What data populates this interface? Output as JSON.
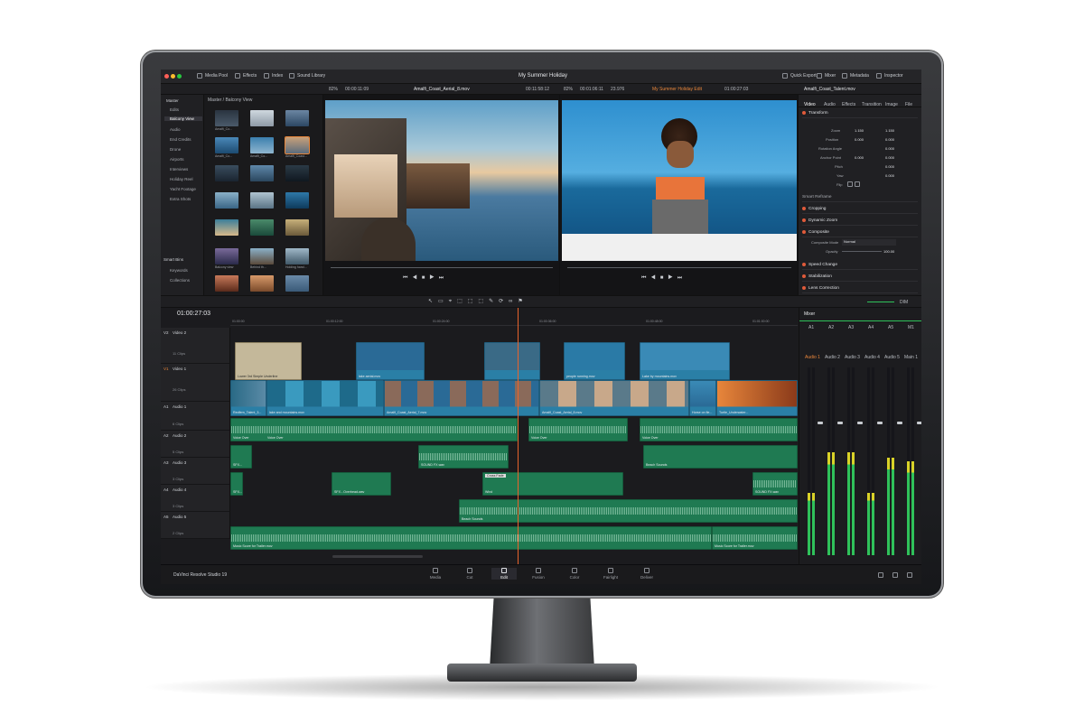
{
  "window": {
    "project_title": "My Summer Holiday",
    "tabs": [
      "Media Pool",
      "Effects",
      "Index",
      "Sound Library"
    ],
    "right_tabs": [
      "Quick Export",
      "Mixer",
      "Metadata",
      "Inspector"
    ]
  },
  "viewer_bar": {
    "zoom_left": "82%",
    "tc_left": "00:00:11:09",
    "clip_left": "Amalfi_Coast_Aerial_8.mov",
    "tc_left2": "00:11:58:12",
    "zoom_right": "82%",
    "tc_right": "00:01:06:11",
    "fps": "23.976",
    "timeline_name": "My Summer Holiday Edit",
    "tc_right2": "01:00:27:03",
    "inspector_clip": "Amalfi_Coast_Talent.mov"
  },
  "bins": {
    "master": "Master",
    "items": [
      "Edits",
      "Balcony View",
      "Audio",
      "End Credits",
      "Drone",
      "Airports",
      "Interviews",
      "Holiday Reel",
      "Yacht Footage",
      "Extra Shots"
    ],
    "smart_bins": "Smart Bins",
    "smart_items": [
      "Keywords",
      "Collections"
    ]
  },
  "pool": {
    "path": "Master / Balcony View",
    "labels": [
      "Amalfi_Co...",
      "Amalfi_Co...",
      "Amalfi_Co...",
      "Amalfi_Co...",
      "Amalfi_Co...",
      "Amalfi_Coast...",
      "Balcony view",
      "Behind th...",
      "Holding hand..."
    ]
  },
  "inspector": {
    "tabs": [
      "Video",
      "Audio",
      "Effects",
      "Transition",
      "Image",
      "File"
    ],
    "transform": "Transform",
    "fields": [
      {
        "label": "Zoom",
        "x": "1.150",
        "y": "1.150"
      },
      {
        "label": "Position",
        "x": "0.000",
        "y": "0.000"
      },
      {
        "label": "Rotation Angle",
        "x": "",
        "y": "0.000"
      },
      {
        "label": "Anchor Point",
        "x": "0.000",
        "y": "0.000"
      },
      {
        "label": "Pitch",
        "x": "",
        "y": "0.000"
      },
      {
        "label": "Yaw",
        "x": "",
        "y": "0.000"
      },
      {
        "label": "Flip",
        "x": "",
        "y": ""
      }
    ],
    "smart_reframe": "Smart Reframe",
    "cropping": "Cropping",
    "dynamic_zoom": "Dynamic Zoom",
    "composite": "Composite",
    "composite_mode_label": "Composite Mode",
    "composite_mode": "Normal",
    "opacity_label": "Opacity",
    "opacity": "100.00",
    "speed_change": "Speed Change",
    "stabilization": "Stabilization",
    "lens_correction": "Lens Correction"
  },
  "timeline": {
    "timecode": "01:00:27:03",
    "ruler": [
      "01:00:00",
      "01:00:12:00",
      "01:00:24:00",
      "01:00:36:00",
      "01:00:48:00",
      "01:01:00:00"
    ],
    "tracks": [
      {
        "id": "V2",
        "name": "Video 2",
        "clips": "11 Clips"
      },
      {
        "id": "V1",
        "name": "Video 1",
        "clips": "26 Clips"
      },
      {
        "id": "A1",
        "name": "Audio 1",
        "clips": "6 Clips"
      },
      {
        "id": "A2",
        "name": "Audio 2",
        "clips": "5 Clips"
      },
      {
        "id": "A3",
        "name": "Audio 3",
        "clips": "3 Clips"
      },
      {
        "id": "A4",
        "name": "Audio 4",
        "clips": "3 Clips"
      },
      {
        "id": "A5",
        "name": "Audio 5",
        "clips": "2 Clips"
      }
    ],
    "v2_clips": [
      "Lower 3rd Simple Underline",
      "lake aerial.mov",
      "people running.mov",
      "Lake by mountains.mov"
    ],
    "v1_clips": [
      "Redfern_Talent_3...",
      "lake and mountains.mov",
      "Amalfi_Coast_Aerial_7.mov",
      "Amalfi_Coast_Aerial_8.mov",
      "Horse on fie...",
      "Turtle_Underwater..."
    ],
    "a1_clips": [
      "Voice Over",
      "Voice Over",
      "Voice Over",
      "Voice Over"
    ],
    "a2_clips": [
      "SFX...",
      "SOUND FX.wav",
      "Beach Sounds"
    ],
    "a3_clips": [
      "SFX...",
      "SFX - Overhead.wav",
      "Cross Fade",
      "Wind",
      "SOUND FX.wav"
    ],
    "a4_clips": [
      "Beach Sounds"
    ],
    "a5_clips": [
      "Music Score for Trailer.mov",
      "Music Score for Trailer.mov"
    ]
  },
  "mixer": {
    "title": "Mixer",
    "channels": [
      "A1",
      "A2",
      "A3",
      "A4",
      "A5",
      "M1"
    ],
    "strips": [
      "Audio 1",
      "Audio 2",
      "Audio 3",
      "Audio 4",
      "Audio 5",
      "Main 1"
    ],
    "levels": [
      0.33,
      0.55,
      0.55,
      0.33,
      0.52,
      0.5
    ],
    "dim_label": "DIM"
  },
  "pages": [
    "Media",
    "Cut",
    "Edit",
    "Fusion",
    "Color",
    "Fairlight",
    "Deliver"
  ],
  "app_name": "DaVinci Resolve Studio 19"
}
